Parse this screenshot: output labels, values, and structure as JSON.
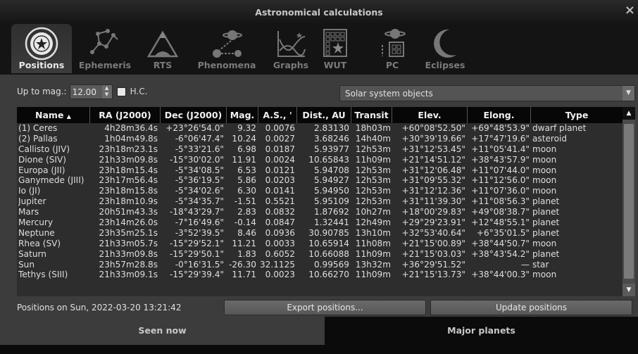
{
  "window": {
    "title": "Astronomical calculations",
    "close_glyph": "×"
  },
  "tabs": [
    {
      "label": "Positions",
      "icon": "target-icon",
      "active": true
    },
    {
      "label": "Ephemeris",
      "icon": "constellation-icon",
      "active": false
    },
    {
      "label": "RTS",
      "icon": "mountain-icon",
      "active": false
    },
    {
      "label": "Phenomena",
      "icon": "planets-icon",
      "active": false
    },
    {
      "label": "Graphs",
      "icon": "graph-icon",
      "active": false
    },
    {
      "label": "WUT",
      "icon": "calendar-icon",
      "active": false
    },
    {
      "label": "PC",
      "icon": "planet-calendar-icon",
      "active": false
    },
    {
      "label": "Eclipses",
      "icon": "crescent-icon",
      "active": false
    }
  ],
  "filters": {
    "mag_label": "Up to mag.:",
    "mag_value": "12.00",
    "hc_label": "H.C.",
    "object_type": "Solar system objects"
  },
  "table": {
    "columns": [
      "Name",
      "RA (J2000)",
      "Dec (J2000)",
      "Mag.",
      "A.S., '",
      "Dist., AU",
      "Transit",
      "Elev.",
      "Elong.",
      "Type"
    ],
    "sort_indicator": "▲",
    "rows": [
      [
        "(1) Ceres",
        "4h28m36.4s",
        "+23°26'54.0\"",
        "9.32",
        "0.0076",
        "2.83130",
        "18h03m",
        "+60°08'52.50\"",
        "+69°48'53.9\"",
        "dwarf planet"
      ],
      [
        "(2) Pallas",
        "1h04m49.8s",
        "-6°06'47.4\"",
        "10.24",
        "0.0027",
        "3.68246",
        "14h40m",
        "+30°39'19.66\"",
        "+17°47'19.6\"",
        "asteroid"
      ],
      [
        "Callisto (JIV)",
        "23h18m23.1s",
        "-5°33'21.6\"",
        "6.98",
        "0.0187",
        "5.93977",
        "12h53m",
        "+31°12'53.45\"",
        "+11°05'41.4\"",
        "moon"
      ],
      [
        "Dione (SIV)",
        "21h33m09.8s",
        "-15°30'02.0\"",
        "11.91",
        "0.0024",
        "10.65843",
        "11h09m",
        "+21°14'51.12\"",
        "+38°43'57.9\"",
        "moon"
      ],
      [
        "Europa (JII)",
        "23h18m15.4s",
        "-5°34'08.5\"",
        "6.53",
        "0.0121",
        "5.94708",
        "12h53m",
        "+31°12'06.48\"",
        "+11°07'44.0\"",
        "moon"
      ],
      [
        "Ganymede (JIII)",
        "23h17m56.4s",
        "-5°36'19.5\"",
        "5.86",
        "0.0203",
        "5.94927",
        "12h53m",
        "+31°09'55.32\"",
        "+11°12'56.0\"",
        "moon"
      ],
      [
        "Io (JI)",
        "23h18m15.8s",
        "-5°34'02.6\"",
        "6.30",
        "0.0141",
        "5.94950",
        "12h53m",
        "+31°12'12.36\"",
        "+11°07'36.0\"",
        "moon"
      ],
      [
        "Jupiter",
        "23h18m10.9s",
        "-5°34'35.7\"",
        "-1.51",
        "0.5521",
        "5.95109",
        "12h53m",
        "+31°11'39.30\"",
        "+11°08'56.3\"",
        "planet"
      ],
      [
        "Mars",
        "20h51m43.3s",
        "-18°43'29.7\"",
        "2.83",
        "0.0832",
        "1.87692",
        "10h27m",
        "+18°00'29.83\"",
        "+49°08'38.7\"",
        "planet"
      ],
      [
        "Mercury",
        "23h14m26.0s",
        "-7°16'49.6\"",
        "-0.14",
        "0.0847",
        "1.32441",
        "12h49m",
        "+29°29'23.91\"",
        "+12°48'55.1\"",
        "planet"
      ],
      [
        "Neptune",
        "23h35m25.1s",
        "-3°52'39.5\"",
        "8.46",
        "0.0936",
        "30.90785",
        "13h10m",
        "+32°53'40.64\"",
        "+6°35'01.5\"",
        "planet"
      ],
      [
        "Rhea (SV)",
        "21h33m05.7s",
        "-15°29'52.1\"",
        "11.21",
        "0.0033",
        "10.65914",
        "11h08m",
        "+21°15'00.89\"",
        "+38°44'50.7\"",
        "moon"
      ],
      [
        "Saturn",
        "21h33m09.8s",
        "-15°29'50.1\"",
        "1.83",
        "0.6052",
        "10.66088",
        "11h09m",
        "+21°15'03.03\"",
        "+38°43'54.2\"",
        "planet"
      ],
      [
        "Sun",
        "23h57m28.8s",
        "-0°16'31.5\"",
        "-26.30",
        "32.1125",
        "0.99569",
        "13h32m",
        "+36°29'51.52\"",
        "—",
        "star"
      ],
      [
        "Tethys (SIII)",
        "21h33m09.1s",
        "-15°29'39.4\"",
        "11.71",
        "0.0023",
        "10.66270",
        "11h09m",
        "+21°15'13.73\"",
        "+38°44'00.3\"",
        "moon"
      ]
    ]
  },
  "footer": {
    "timestamp": "Positions on Sun, 2022-03-20 13:21:42",
    "export_label": "Export positions...",
    "update_label": "Update positions"
  },
  "bottom_tabs": [
    {
      "label": "Seen now",
      "active": true
    },
    {
      "label": "Major planets",
      "active": false
    }
  ],
  "colors": {
    "panel": "#3c3c3c",
    "header": "#070707",
    "background": "#0b0b0b"
  }
}
